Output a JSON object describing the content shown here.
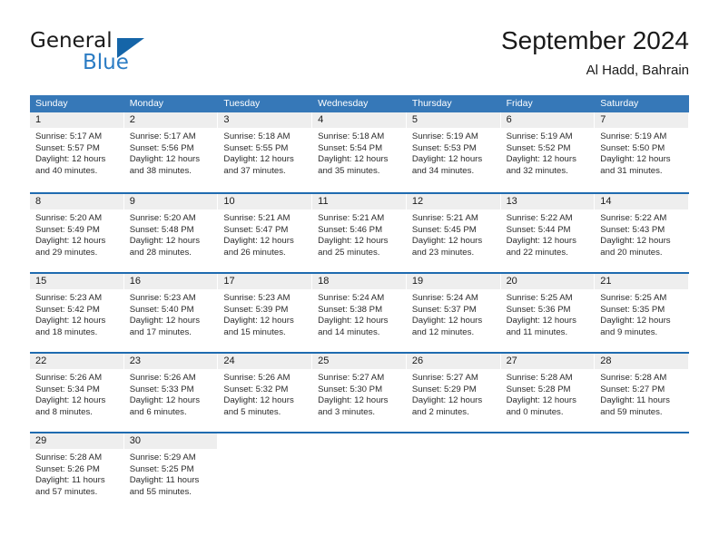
{
  "brand": {
    "name_part1": "General",
    "name_part2": "Blue",
    "triangle_color": "#1565a8",
    "blue_color": "#2b7cc4"
  },
  "header": {
    "month_title": "September 2024",
    "location": "Al Hadd, Bahrain"
  },
  "theme": {
    "header_row_bg": "#3678b8",
    "row_separator": "#1f6bb0",
    "day_number_bg": "#eeeeee"
  },
  "weekdays": [
    "Sunday",
    "Monday",
    "Tuesday",
    "Wednesday",
    "Thursday",
    "Friday",
    "Saturday"
  ],
  "weeks": [
    [
      {
        "day": "1",
        "sunrise": "Sunrise: 5:17 AM",
        "sunset": "Sunset: 5:57 PM",
        "daylight": "Daylight: 12 hours and 40 minutes."
      },
      {
        "day": "2",
        "sunrise": "Sunrise: 5:17 AM",
        "sunset": "Sunset: 5:56 PM",
        "daylight": "Daylight: 12 hours and 38 minutes."
      },
      {
        "day": "3",
        "sunrise": "Sunrise: 5:18 AM",
        "sunset": "Sunset: 5:55 PM",
        "daylight": "Daylight: 12 hours and 37 minutes."
      },
      {
        "day": "4",
        "sunrise": "Sunrise: 5:18 AM",
        "sunset": "Sunset: 5:54 PM",
        "daylight": "Daylight: 12 hours and 35 minutes."
      },
      {
        "day": "5",
        "sunrise": "Sunrise: 5:19 AM",
        "sunset": "Sunset: 5:53 PM",
        "daylight": "Daylight: 12 hours and 34 minutes."
      },
      {
        "day": "6",
        "sunrise": "Sunrise: 5:19 AM",
        "sunset": "Sunset: 5:52 PM",
        "daylight": "Daylight: 12 hours and 32 minutes."
      },
      {
        "day": "7",
        "sunrise": "Sunrise: 5:19 AM",
        "sunset": "Sunset: 5:50 PM",
        "daylight": "Daylight: 12 hours and 31 minutes."
      }
    ],
    [
      {
        "day": "8",
        "sunrise": "Sunrise: 5:20 AM",
        "sunset": "Sunset: 5:49 PM",
        "daylight": "Daylight: 12 hours and 29 minutes."
      },
      {
        "day": "9",
        "sunrise": "Sunrise: 5:20 AM",
        "sunset": "Sunset: 5:48 PM",
        "daylight": "Daylight: 12 hours and 28 minutes."
      },
      {
        "day": "10",
        "sunrise": "Sunrise: 5:21 AM",
        "sunset": "Sunset: 5:47 PM",
        "daylight": "Daylight: 12 hours and 26 minutes."
      },
      {
        "day": "11",
        "sunrise": "Sunrise: 5:21 AM",
        "sunset": "Sunset: 5:46 PM",
        "daylight": "Daylight: 12 hours and 25 minutes."
      },
      {
        "day": "12",
        "sunrise": "Sunrise: 5:21 AM",
        "sunset": "Sunset: 5:45 PM",
        "daylight": "Daylight: 12 hours and 23 minutes."
      },
      {
        "day": "13",
        "sunrise": "Sunrise: 5:22 AM",
        "sunset": "Sunset: 5:44 PM",
        "daylight": "Daylight: 12 hours and 22 minutes."
      },
      {
        "day": "14",
        "sunrise": "Sunrise: 5:22 AM",
        "sunset": "Sunset: 5:43 PM",
        "daylight": "Daylight: 12 hours and 20 minutes."
      }
    ],
    [
      {
        "day": "15",
        "sunrise": "Sunrise: 5:23 AM",
        "sunset": "Sunset: 5:42 PM",
        "daylight": "Daylight: 12 hours and 18 minutes."
      },
      {
        "day": "16",
        "sunrise": "Sunrise: 5:23 AM",
        "sunset": "Sunset: 5:40 PM",
        "daylight": "Daylight: 12 hours and 17 minutes."
      },
      {
        "day": "17",
        "sunrise": "Sunrise: 5:23 AM",
        "sunset": "Sunset: 5:39 PM",
        "daylight": "Daylight: 12 hours and 15 minutes."
      },
      {
        "day": "18",
        "sunrise": "Sunrise: 5:24 AM",
        "sunset": "Sunset: 5:38 PM",
        "daylight": "Daylight: 12 hours and 14 minutes."
      },
      {
        "day": "19",
        "sunrise": "Sunrise: 5:24 AM",
        "sunset": "Sunset: 5:37 PM",
        "daylight": "Daylight: 12 hours and 12 minutes."
      },
      {
        "day": "20",
        "sunrise": "Sunrise: 5:25 AM",
        "sunset": "Sunset: 5:36 PM",
        "daylight": "Daylight: 12 hours and 11 minutes."
      },
      {
        "day": "21",
        "sunrise": "Sunrise: 5:25 AM",
        "sunset": "Sunset: 5:35 PM",
        "daylight": "Daylight: 12 hours and 9 minutes."
      }
    ],
    [
      {
        "day": "22",
        "sunrise": "Sunrise: 5:26 AM",
        "sunset": "Sunset: 5:34 PM",
        "daylight": "Daylight: 12 hours and 8 minutes."
      },
      {
        "day": "23",
        "sunrise": "Sunrise: 5:26 AM",
        "sunset": "Sunset: 5:33 PM",
        "daylight": "Daylight: 12 hours and 6 minutes."
      },
      {
        "day": "24",
        "sunrise": "Sunrise: 5:26 AM",
        "sunset": "Sunset: 5:32 PM",
        "daylight": "Daylight: 12 hours and 5 minutes."
      },
      {
        "day": "25",
        "sunrise": "Sunrise: 5:27 AM",
        "sunset": "Sunset: 5:30 PM",
        "daylight": "Daylight: 12 hours and 3 minutes."
      },
      {
        "day": "26",
        "sunrise": "Sunrise: 5:27 AM",
        "sunset": "Sunset: 5:29 PM",
        "daylight": "Daylight: 12 hours and 2 minutes."
      },
      {
        "day": "27",
        "sunrise": "Sunrise: 5:28 AM",
        "sunset": "Sunset: 5:28 PM",
        "daylight": "Daylight: 12 hours and 0 minutes."
      },
      {
        "day": "28",
        "sunrise": "Sunrise: 5:28 AM",
        "sunset": "Sunset: 5:27 PM",
        "daylight": "Daylight: 11 hours and 59 minutes."
      }
    ],
    [
      {
        "day": "29",
        "sunrise": "Sunrise: 5:28 AM",
        "sunset": "Sunset: 5:26 PM",
        "daylight": "Daylight: 11 hours and 57 minutes."
      },
      {
        "day": "30",
        "sunrise": "Sunrise: 5:29 AM",
        "sunset": "Sunset: 5:25 PM",
        "daylight": "Daylight: 11 hours and 55 minutes."
      },
      {
        "day": "",
        "sunrise": "",
        "sunset": "",
        "daylight": ""
      },
      {
        "day": "",
        "sunrise": "",
        "sunset": "",
        "daylight": ""
      },
      {
        "day": "",
        "sunrise": "",
        "sunset": "",
        "daylight": ""
      },
      {
        "day": "",
        "sunrise": "",
        "sunset": "",
        "daylight": ""
      },
      {
        "day": "",
        "sunrise": "",
        "sunset": "",
        "daylight": ""
      }
    ]
  ]
}
